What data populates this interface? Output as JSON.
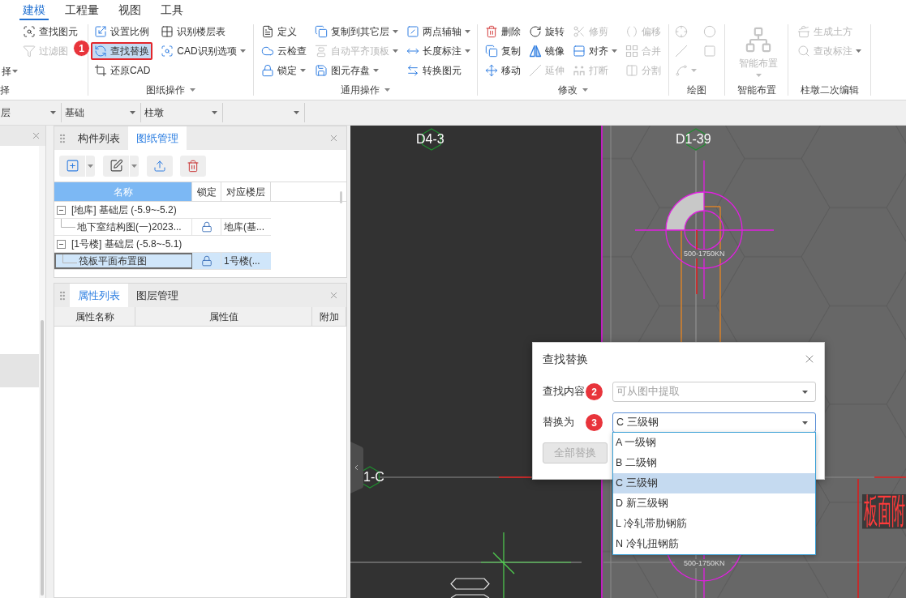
{
  "menu_tabs": [
    {
      "label": "建模",
      "selected": true
    },
    {
      "label": "工程量",
      "selected": false
    },
    {
      "label": "视图",
      "selected": false
    },
    {
      "label": "工具",
      "selected": false
    }
  ],
  "ribbon": {
    "groups": [
      {
        "label": "择",
        "has_menu": false,
        "columns": [
          [
            {
              "kind": "small",
              "label": "择",
              "dropdown": true,
              "disabled": false,
              "active": false,
              "marked": false
            }
          ],
          [
            {
              "kind": "small",
              "label": "查找图元",
              "dropdown": false,
              "disabled": false,
              "active": false,
              "marked": false
            },
            {
              "kind": "small",
              "label": "过滤图",
              "dropdown": false,
              "disabled": true,
              "active": false,
              "marked": false,
              "badge": "1"
            }
          ]
        ]
      },
      {
        "label": "图纸操作",
        "has_menu": true,
        "columns": [
          [
            {
              "kind": "small",
              "label": "设置比例",
              "dropdown": false,
              "disabled": false,
              "active": false,
              "marked": false
            },
            {
              "kind": "small",
              "label": "查找替换",
              "dropdown": false,
              "disabled": false,
              "active": true,
              "marked": true
            },
            {
              "kind": "small",
              "label": "还原CAD",
              "dropdown": false,
              "disabled": false,
              "active": false,
              "marked": false
            }
          ],
          [
            {
              "kind": "small",
              "label": "识别楼层表",
              "dropdown": false,
              "disabled": false,
              "active": false,
              "marked": false
            },
            {
              "kind": "small",
              "label": "CAD识别选项",
              "dropdown": true,
              "disabled": false,
              "active": false,
              "marked": false
            }
          ]
        ]
      },
      {
        "label": "通用操作",
        "has_menu": true,
        "columns": [
          [
            {
              "kind": "small",
              "label": "定义",
              "dropdown": false,
              "disabled": false,
              "active": false,
              "marked": false
            },
            {
              "kind": "small",
              "label": "云检查",
              "dropdown": false,
              "disabled": false,
              "active": false,
              "marked": false
            },
            {
              "kind": "small",
              "label": "锁定",
              "dropdown": true,
              "disabled": false,
              "active": false,
              "marked": false
            }
          ],
          [
            {
              "kind": "small",
              "label": "复制到其它层",
              "dropdown": true,
              "disabled": false,
              "active": false,
              "marked": false
            },
            {
              "kind": "small",
              "label": "自动平齐顶板",
              "dropdown": true,
              "disabled": true,
              "active": false,
              "marked": false
            },
            {
              "kind": "small",
              "label": "图元存盘",
              "dropdown": true,
              "disabled": false,
              "active": false,
              "marked": false
            }
          ],
          [
            {
              "kind": "small",
              "label": "两点辅轴",
              "dropdown": true,
              "disabled": false,
              "active": false,
              "marked": false
            },
            {
              "kind": "small",
              "label": "长度标注",
              "dropdown": true,
              "disabled": false,
              "active": false,
              "marked": false
            },
            {
              "kind": "small",
              "label": "转换图元",
              "dropdown": false,
              "disabled": false,
              "active": false,
              "marked": false
            }
          ]
        ]
      },
      {
        "label": "修改",
        "has_menu": true,
        "columns": [
          [
            {
              "kind": "small",
              "label": "删除",
              "dropdown": false,
              "disabled": false,
              "active": false,
              "marked": false
            },
            {
              "kind": "small",
              "label": "复制",
              "dropdown": false,
              "disabled": false,
              "active": false,
              "marked": false
            },
            {
              "kind": "small",
              "label": "移动",
              "dropdown": false,
              "disabled": false,
              "active": false,
              "marked": false
            }
          ],
          [
            {
              "kind": "small",
              "label": "旋转",
              "dropdown": false,
              "disabled": false,
              "active": false,
              "marked": false
            },
            {
              "kind": "small",
              "label": "镜像",
              "dropdown": false,
              "disabled": false,
              "active": false,
              "marked": false
            },
            {
              "kind": "small",
              "label": "延伸",
              "dropdown": false,
              "disabled": true,
              "active": false,
              "marked": false
            }
          ],
          [
            {
              "kind": "small",
              "label": "修剪",
              "dropdown": false,
              "disabled": true,
              "active": false,
              "marked": false
            },
            {
              "kind": "small",
              "label": "对齐",
              "dropdown": true,
              "disabled": false,
              "active": false,
              "marked": false
            },
            {
              "kind": "small",
              "label": "打断",
              "dropdown": false,
              "disabled": true,
              "active": false,
              "marked": false
            }
          ],
          [
            {
              "kind": "small",
              "label": "偏移",
              "dropdown": false,
              "disabled": true,
              "active": false,
              "marked": false
            },
            {
              "kind": "small",
              "label": "合并",
              "dropdown": false,
              "disabled": true,
              "active": false,
              "marked": false
            },
            {
              "kind": "small",
              "label": "分割",
              "dropdown": false,
              "disabled": true,
              "active": false,
              "marked": false
            }
          ]
        ]
      },
      {
        "label": "绘图",
        "has_menu": false,
        "columns": [
          [
            {
              "kind": "icon",
              "dropdown": false,
              "disabled": true,
              "active": false,
              "marked": false
            },
            {
              "kind": "icon",
              "dropdown": false,
              "disabled": true,
              "active": false,
              "marked": false
            },
            {
              "kind": "icon",
              "dropdown": true,
              "disabled": true,
              "active": false,
              "marked": false
            }
          ],
          [
            {
              "kind": "icon",
              "dropdown": false,
              "disabled": true,
              "active": false,
              "marked": false
            },
            {
              "kind": "icon",
              "dropdown": false,
              "disabled": true,
              "active": false,
              "marked": false
            }
          ]
        ]
      },
      {
        "label": "智能布置",
        "has_menu": false,
        "columns": [
          [
            {
              "kind": "large",
              "label": "智能布置",
              "dropdown": true,
              "disabled": true,
              "active": false,
              "marked": false
            }
          ]
        ]
      },
      {
        "label": "柱墩二次编辑",
        "has_menu": false,
        "columns": [
          [
            {
              "kind": "small",
              "label": "生成土方",
              "dropdown": false,
              "disabled": true,
              "active": false,
              "marked": false
            },
            {
              "kind": "small",
              "label": "查改标注",
              "dropdown": true,
              "disabled": true,
              "active": false,
              "marked": false
            }
          ]
        ]
      }
    ]
  },
  "selectors": [
    {
      "value": "层"
    },
    {
      "value": "基础"
    },
    {
      "value": "柱墩"
    }
  ],
  "left_panel": {
    "rows": [
      {
        "selected": true
      }
    ]
  },
  "drawings_panel": {
    "tabs": [
      {
        "label": "构件列表",
        "selected": false
      },
      {
        "label": "图纸管理",
        "selected": true
      }
    ],
    "table": {
      "columns": [
        {
          "label": "名称",
          "selected": true
        },
        {
          "label": "锁定",
          "selected": false
        },
        {
          "label": "对应楼层",
          "selected": false
        }
      ],
      "rows": [
        {
          "name": "[地库] 基础层 (-5.9~-5.2)",
          "expanded": true,
          "children": [
            {
              "name": "地下室结构图(一)2023...",
              "locked": true,
              "floor": "地库(基...",
              "selected": false
            }
          ]
        },
        {
          "name": "[1号楼] 基础层 (-5.8~-5.1)",
          "expanded": true,
          "children": [
            {
              "name": "筏板平面布置图",
              "locked": true,
              "floor": "1号楼(...",
              "selected": true
            }
          ]
        }
      ]
    }
  },
  "properties_panel": {
    "tabs": [
      {
        "label": "属性列表",
        "selected": true
      },
      {
        "label": "图层管理",
        "selected": false
      }
    ],
    "columns": [
      "属性名称",
      "属性值",
      "附加"
    ]
  },
  "canvas": {
    "axis_labels": [
      "D4-3",
      "D1-39",
      "1-C"
    ],
    "load_labels": [
      "500-1750KN",
      "500-1750KN"
    ],
    "note": "板面附"
  },
  "dialog": {
    "title": "查找替换",
    "fields": [
      {
        "label": "查找内容",
        "badge": "2",
        "placeholder": "可从图中提取",
        "expanded": false
      },
      {
        "label": "替换为",
        "badge": "3",
        "value": "C 三级钢",
        "expanded": true,
        "options": [
          {
            "label": "A 一级钢",
            "selected": false
          },
          {
            "label": "B 二级钢",
            "selected": false
          },
          {
            "label": "C 三级钢",
            "selected": true
          },
          {
            "label": "D 新三级钢",
            "selected": false
          },
          {
            "label": "L 冷轧带肋钢筋",
            "selected": false
          },
          {
            "label": "N 冷轧扭钢筋",
            "selected": false
          }
        ]
      }
    ],
    "button": {
      "label": "全部替换",
      "disabled": true
    }
  }
}
